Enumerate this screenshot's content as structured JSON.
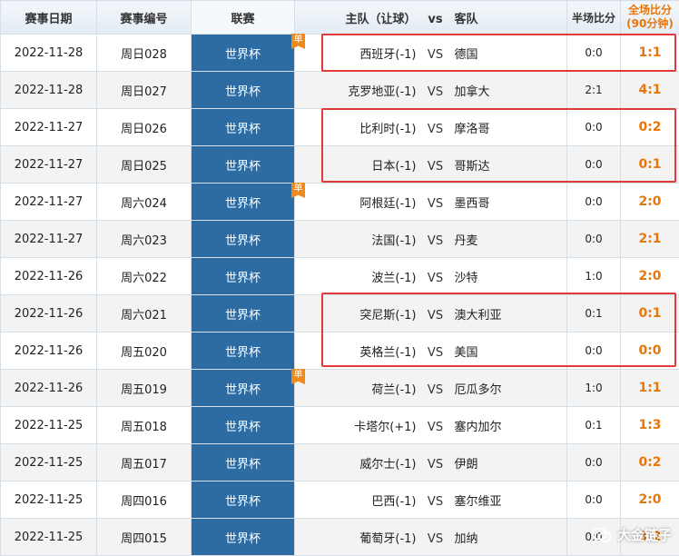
{
  "headers": {
    "date": "赛事日期",
    "code": "赛事编号",
    "league": "联赛",
    "home": "主队（让球）",
    "vs": "vs",
    "away": "客队",
    "half": "半场比分",
    "full_line1": "全场比分",
    "full_line2": "(90分钟)"
  },
  "badge_label": "单",
  "vs_label": "VS",
  "rows": [
    {
      "date": "2022-11-28",
      "code": "周日028",
      "league": "世界杯",
      "home": "西班牙(-1)",
      "away": "德国",
      "half": "0:0",
      "full": "1:1",
      "single": true
    },
    {
      "date": "2022-11-28",
      "code": "周日027",
      "league": "世界杯",
      "home": "克罗地亚(-1)",
      "away": "加拿大",
      "half": "2:1",
      "full": "4:1",
      "single": false
    },
    {
      "date": "2022-11-27",
      "code": "周日026",
      "league": "世界杯",
      "home": "比利时(-1)",
      "away": "摩洛哥",
      "half": "0:0",
      "full": "0:2",
      "single": false
    },
    {
      "date": "2022-11-27",
      "code": "周日025",
      "league": "世界杯",
      "home": "日本(-1)",
      "away": "哥斯达",
      "half": "0:0",
      "full": "0:1",
      "single": false
    },
    {
      "date": "2022-11-27",
      "code": "周六024",
      "league": "世界杯",
      "home": "阿根廷(-1)",
      "away": "墨西哥",
      "half": "0:0",
      "full": "2:0",
      "single": true
    },
    {
      "date": "2022-11-27",
      "code": "周六023",
      "league": "世界杯",
      "home": "法国(-1)",
      "away": "丹麦",
      "half": "0:0",
      "full": "2:1",
      "single": false
    },
    {
      "date": "2022-11-26",
      "code": "周六022",
      "league": "世界杯",
      "home": "波兰(-1)",
      "away": "沙特",
      "half": "1:0",
      "full": "2:0",
      "single": false
    },
    {
      "date": "2022-11-26",
      "code": "周六021",
      "league": "世界杯",
      "home": "突尼斯(-1)",
      "away": "澳大利亚",
      "half": "0:1",
      "full": "0:1",
      "single": false
    },
    {
      "date": "2022-11-26",
      "code": "周五020",
      "league": "世界杯",
      "home": "英格兰(-1)",
      "away": "美国",
      "half": "0:0",
      "full": "0:0",
      "single": false
    },
    {
      "date": "2022-11-26",
      "code": "周五019",
      "league": "世界杯",
      "home": "荷兰(-1)",
      "away": "厄瓜多尔",
      "half": "1:0",
      "full": "1:1",
      "single": true
    },
    {
      "date": "2022-11-25",
      "code": "周五018",
      "league": "世界杯",
      "home": "卡塔尔(+1)",
      "away": "塞内加尔",
      "half": "0:1",
      "full": "1:3",
      "single": false
    },
    {
      "date": "2022-11-25",
      "code": "周五017",
      "league": "世界杯",
      "home": "威尔士(-1)",
      "away": "伊朗",
      "half": "0:0",
      "full": "0:2",
      "single": false
    },
    {
      "date": "2022-11-25",
      "code": "周四016",
      "league": "世界杯",
      "home": "巴西(-1)",
      "away": "塞尔维亚",
      "half": "0:0",
      "full": "2:0",
      "single": false
    },
    {
      "date": "2022-11-25",
      "code": "周四015",
      "league": "世界杯",
      "home": "葡萄牙(-1)",
      "away": "加纳",
      "half": "0:0",
      "full": "3:2",
      "single": false
    }
  ],
  "watermark": "大金链子",
  "colors": {
    "league_bg": "#2c6ca3",
    "score_orange": "#e8760a",
    "badge_orange": "#f08a1c",
    "highlight_red": "#e23a3a"
  }
}
